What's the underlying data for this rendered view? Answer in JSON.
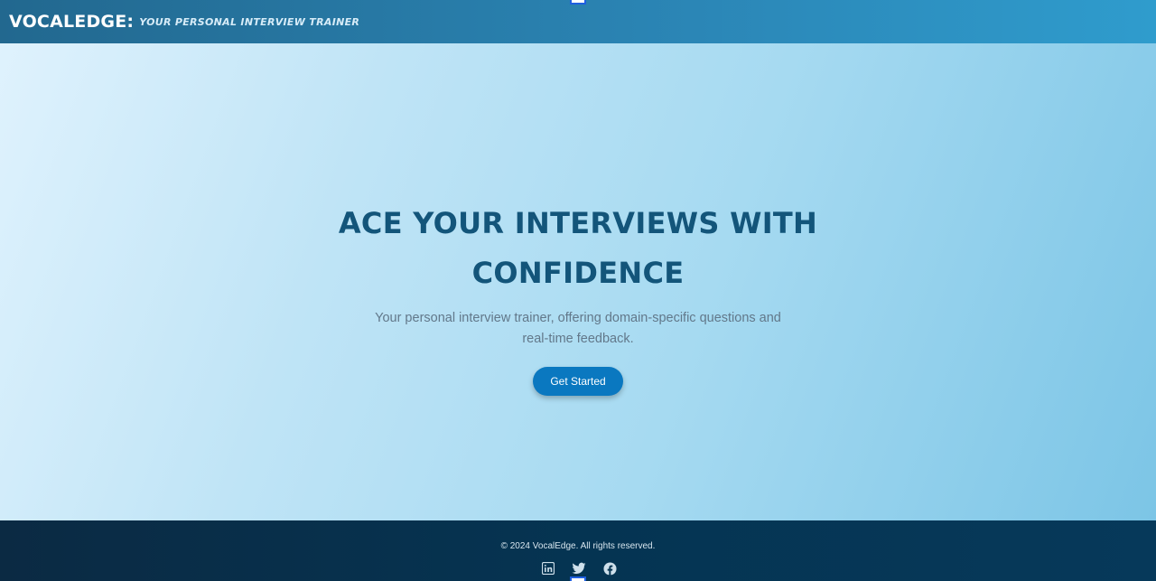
{
  "header": {
    "brand": "VOCALEDGE:",
    "tagline": "YOUR PERSONAL INTERVIEW TRAINER"
  },
  "hero": {
    "title": "ACE YOUR INTERVIEWS WITH CONFIDENCE",
    "subtitle": "Your personal interview trainer, offering domain-specific questions and real-time feedback.",
    "cta_label": "Get Started"
  },
  "footer": {
    "copyright": "© 2024 VocalEdge. All rights reserved.",
    "socials": [
      {
        "icon": "linkedin-icon"
      },
      {
        "icon": "twitter-icon"
      },
      {
        "icon": "facebook-icon"
      }
    ]
  },
  "colors": {
    "header_start": "#22688f",
    "header_end": "#2f9ccd",
    "hero_title": "#13557a",
    "cta_bg": "#0a78c0",
    "footer_bg": "#053452"
  }
}
